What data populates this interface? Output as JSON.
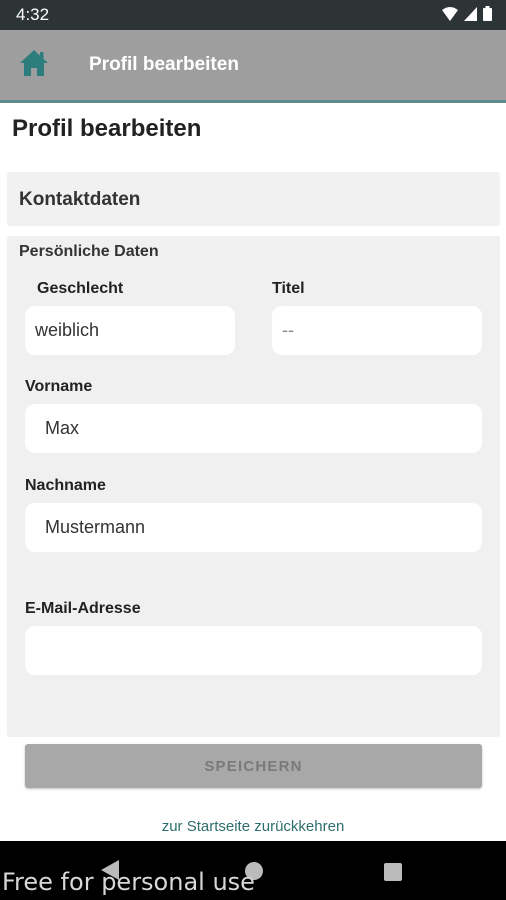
{
  "status_bar": {
    "time": "4:32"
  },
  "app_bar": {
    "title": "Profil bearbeiten",
    "home_icon": "home-icon"
  },
  "page": {
    "title": "Profil bearbeiten"
  },
  "section": {
    "title": "Kontaktdaten"
  },
  "form": {
    "subtitle": "Persönliche Daten",
    "gender": {
      "label": "Geschlecht",
      "value": "weiblich"
    },
    "title_field": {
      "label": "Titel",
      "value": "--"
    },
    "first_name": {
      "label": "Vorname",
      "value": "Max"
    },
    "last_name": {
      "label": "Nachname",
      "value": "Mustermann"
    },
    "email": {
      "label": "E-Mail-Adresse",
      "value": ""
    }
  },
  "actions": {
    "save_label": "SPEICHERN",
    "back_link": "zur Startseite zurückkehren"
  },
  "watermark": "Free for personal use",
  "colors": {
    "status_bar": "#2d3436",
    "app_bar": "#9e9e9e",
    "accent": "#2e7d7d",
    "link": "#2e6e6e",
    "panel": "#f0f0f0"
  }
}
